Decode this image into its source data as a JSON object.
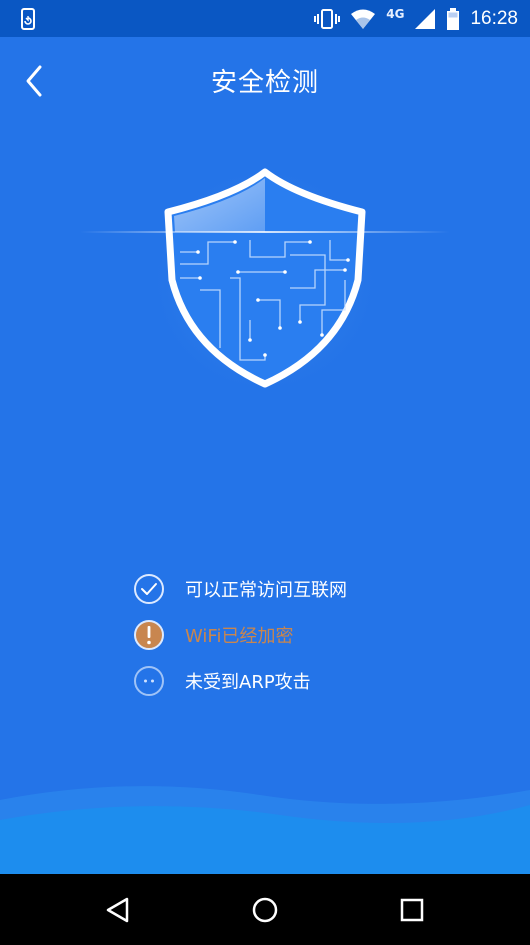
{
  "status_bar": {
    "time": "16:28",
    "network": "4G",
    "icons": [
      "phone-sync-icon",
      "vibrate-icon",
      "wifi-icon",
      "signal-icon",
      "battery-icon"
    ]
  },
  "header": {
    "title": "安全检测",
    "back_icon": "chevron-left-icon"
  },
  "shield": {
    "icon": "shield-icon"
  },
  "checks": [
    {
      "icon": "check-circle-icon",
      "text": "可以正常访问互联网",
      "status": "ok"
    },
    {
      "icon": "warning-circle-icon",
      "text": "WiFi已经加密",
      "status": "warning"
    },
    {
      "icon": "pending-circle-icon",
      "text": "未受到ARP攻击",
      "status": "pending"
    }
  ],
  "colors": {
    "background": "#2474e8",
    "status_bar": "#0a57c3",
    "warning": "#c8864f",
    "nav_bar": "#000000"
  },
  "nav": {
    "back_icon": "nav-back-icon",
    "home_icon": "nav-home-icon",
    "recents_icon": "nav-recents-icon"
  }
}
